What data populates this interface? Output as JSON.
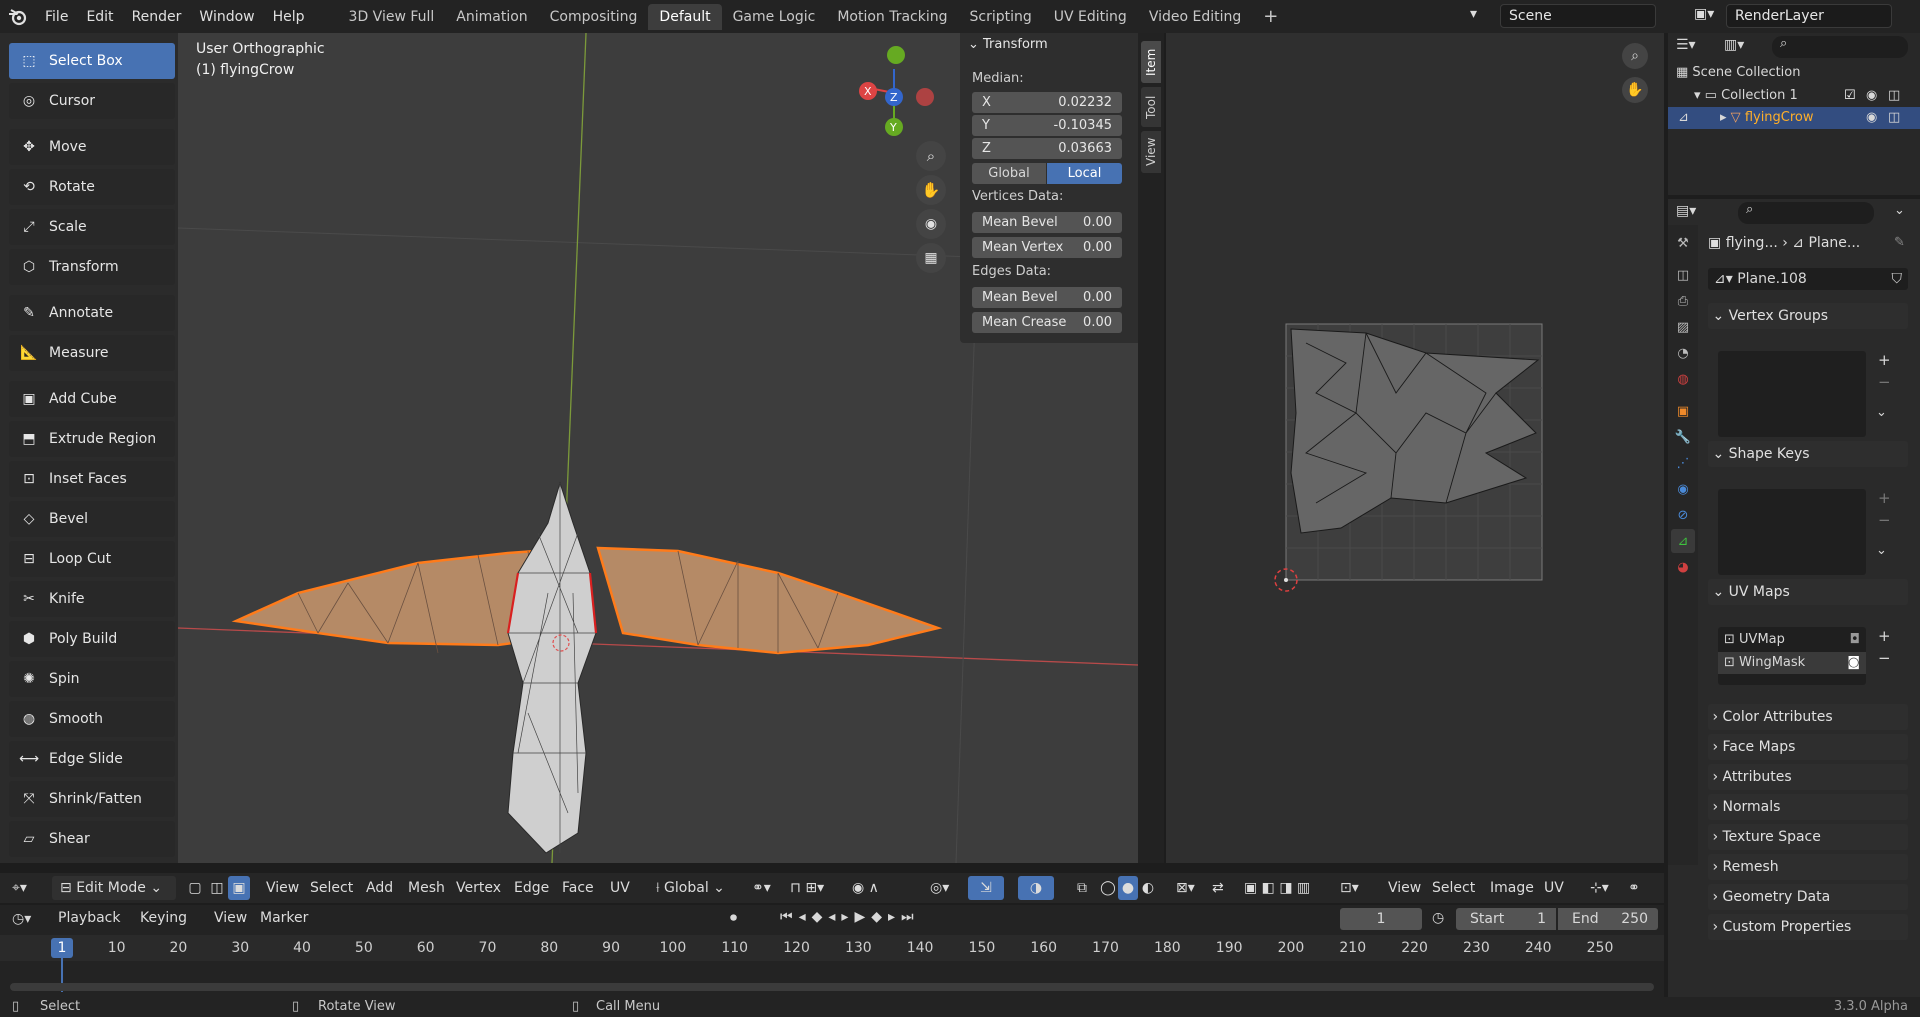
{
  "menubar": {
    "items": [
      "File",
      "Edit",
      "Render",
      "Window",
      "Help"
    ],
    "workspaces": [
      "3D View Full",
      "Animation",
      "Compositing",
      "Default",
      "Game Logic",
      "Motion Tracking",
      "Scripting",
      "UV Editing",
      "Video Editing"
    ],
    "active_workspace": "Default",
    "scene": "Scene",
    "render_layer": "RenderLayer"
  },
  "toolbar": {
    "tools": [
      "Select Box",
      "Cursor",
      "Move",
      "Rotate",
      "Scale",
      "Transform",
      "Annotate",
      "Measure",
      "Add Cube",
      "Extrude Region",
      "Inset Faces",
      "Bevel",
      "Loop Cut",
      "Knife",
      "Poly Build",
      "Spin",
      "Smooth",
      "Edge Slide",
      "Shrink/Fatten",
      "Shear"
    ],
    "active": "Select Box"
  },
  "viewport": {
    "view_name": "User Orthographic",
    "object_label": "(1) flyingCrow"
  },
  "npanel": {
    "section": "Transform",
    "median_label": "Median:",
    "x_key": "X",
    "x": "0.02232",
    "y_key": "Y",
    "y": "-0.10345",
    "z_key": "Z",
    "z": "0.03663",
    "global": "Global",
    "local": "Local",
    "vertices_data": "Vertices Data:",
    "mean_bevel_v_key": "Mean Bevel",
    "mean_bevel_v": "0.00",
    "mean_vertex_key": "Mean Vertex",
    "mean_vertex": "0.00",
    "edges_data": "Edges Data:",
    "mean_bevel_e_key": "Mean Bevel",
    "mean_bevel_e": "0.00",
    "mean_crease_key": "Mean Crease",
    "mean_crease": "0.00",
    "tabs": [
      "Item",
      "Tool",
      "View"
    ]
  },
  "headerbar": {
    "mode": "Edit Mode",
    "menus": [
      "View",
      "Select",
      "Add",
      "Mesh",
      "Vertex",
      "Edge",
      "Face",
      "UV"
    ],
    "orientation": "Global",
    "uv_menus": [
      "View",
      "Select",
      "Image",
      "UV"
    ]
  },
  "outliner": {
    "scene_collection": "Scene Collection",
    "collection": "Collection 1",
    "object": "flyingCrow"
  },
  "properties": {
    "breadcrumb_object": "flying...",
    "breadcrumb_mesh": "Plane...",
    "mesh_name": "Plane.108",
    "panels": [
      "Vertex Groups",
      "Shape Keys",
      "UV Maps",
      "Color Attributes",
      "Face Maps",
      "Attributes",
      "Normals",
      "Texture Space",
      "Remesh",
      "Geometry Data",
      "Custom Properties"
    ],
    "uv_maps": [
      "UVMap",
      "WingMask"
    ]
  },
  "timeline": {
    "menus": [
      "Playback",
      "Keying",
      "View",
      "Marker"
    ],
    "current_frame": "1",
    "start_label": "Start",
    "start": "1",
    "end_label": "End",
    "end": "250",
    "ticks": [
      "1",
      "10",
      "20",
      "30",
      "40",
      "50",
      "60",
      "70",
      "80",
      "90",
      "100",
      "110",
      "120",
      "130",
      "140",
      "150",
      "160",
      "170",
      "180",
      "190",
      "200",
      "210",
      "220",
      "230",
      "240",
      "250"
    ]
  },
  "statusbar": {
    "select": "Select",
    "rotate": "Rotate View",
    "call_menu": "Call Menu",
    "version": "3.3.0 Alpha"
  }
}
